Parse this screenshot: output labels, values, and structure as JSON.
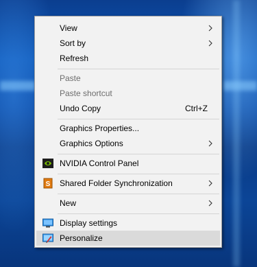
{
  "context_menu": {
    "items": [
      {
        "label": "View",
        "submenu": true
      },
      {
        "label": "Sort by",
        "submenu": true
      },
      {
        "label": "Refresh"
      },
      {
        "label": "Paste",
        "disabled": true
      },
      {
        "label": "Paste shortcut",
        "disabled": true
      },
      {
        "label": "Undo Copy",
        "shortcut": "Ctrl+Z"
      },
      {
        "label": "Graphics Properties..."
      },
      {
        "label": "Graphics Options",
        "submenu": true
      },
      {
        "label": "NVIDIA Control Panel",
        "icon": "nvidia-icon"
      },
      {
        "label": "Shared Folder Synchronization",
        "icon": "shared-folder-sync-icon",
        "submenu": true
      },
      {
        "label": "New",
        "submenu": true
      },
      {
        "label": "Display settings",
        "icon": "display-icon"
      },
      {
        "label": "Personalize",
        "icon": "personalize-icon",
        "highlighted": true
      }
    ]
  },
  "colors": {
    "menu_background": "#f2f2f2",
    "menu_border": "#a0a0a0",
    "highlight": "#dadada",
    "disabled_text": "#6d6d6d",
    "separator": "#d4d4d4",
    "desktop_blue": "#0a4aa6"
  }
}
